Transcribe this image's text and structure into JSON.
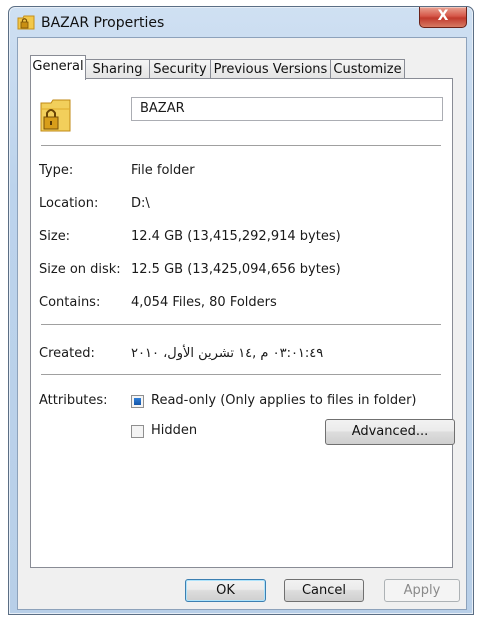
{
  "window": {
    "title": "BAZAR Properties",
    "close_glyph": "X"
  },
  "tabs": [
    "General",
    "Sharing",
    "Security",
    "Previous Versions",
    "Customize"
  ],
  "general": {
    "name_value": "BAZAR",
    "type": {
      "label": "Type:",
      "value": "File folder"
    },
    "location": {
      "label": "Location:",
      "value": "D:\\"
    },
    "size": {
      "label": "Size:",
      "value": "12.4 GB (13,415,292,914 bytes)"
    },
    "size_on_disk": {
      "label": "Size on disk:",
      "value": "12.5 GB (13,425,094,656 bytes)"
    },
    "contains": {
      "label": "Contains:",
      "value": "4,054 Files, 80 Folders"
    },
    "created": {
      "label": "Created:",
      "value": "٠٣:٠١:٤٩ م ,١٤ تشرين الأول، ٢٠١٠"
    },
    "attributes": {
      "label": "Attributes:",
      "readonly_label": "Read-only (Only applies to files in folder)",
      "readonly_state": "indeterminate",
      "hidden_label": "Hidden",
      "hidden_state": "unchecked",
      "advanced_label": "Advanced..."
    }
  },
  "footer": {
    "ok_label": "OK",
    "cancel_label": "Cancel",
    "apply_label": "Apply"
  },
  "icons": {
    "title_icon": "folder-lock-icon",
    "folder_icon": "folder-lock-icon"
  },
  "colors": {
    "accent": "#2f7fd8",
    "close": "#c13a2d",
    "default_button": "#3c7fb1"
  }
}
